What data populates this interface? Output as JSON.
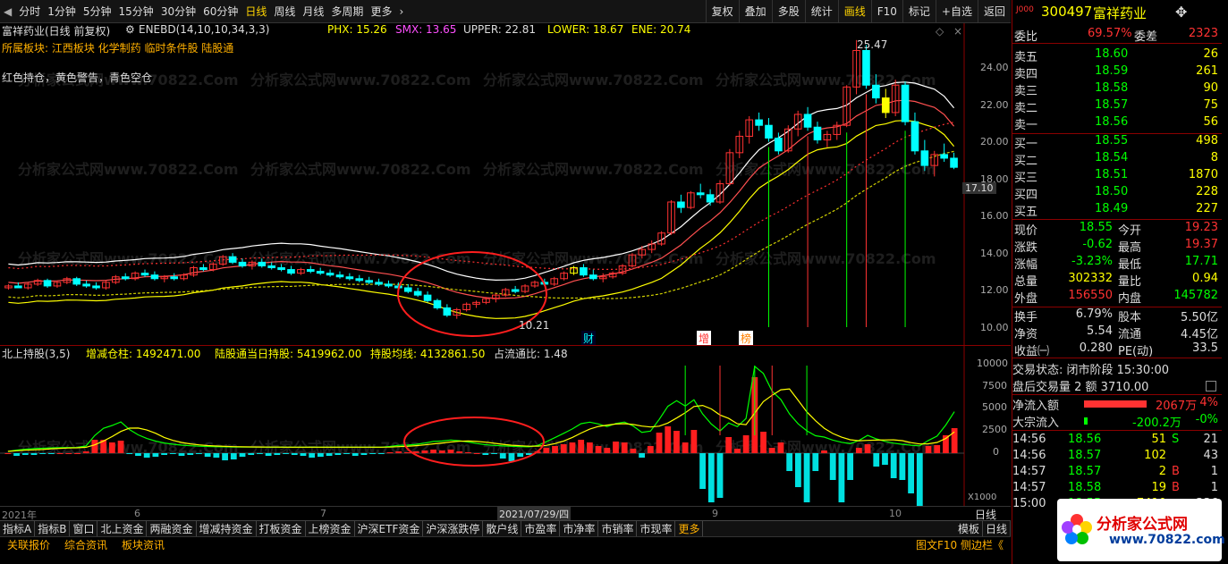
{
  "toolbar": {
    "periods": [
      "分时",
      "1分钟",
      "5分钟",
      "15分钟",
      "30分钟",
      "60分钟",
      "日线",
      "周线",
      "月线",
      "多周期",
      "更多"
    ],
    "active_period": "日线",
    "right_buttons": [
      "复权",
      "叠加",
      "多股",
      "统计",
      "画线",
      "F10",
      "标记",
      "+自选",
      "返回"
    ],
    "active_right": "画线"
  },
  "main": {
    "title": "富祥药业(日线 前复权)",
    "indicator_name": "ENEBD(14,10,10,34,3,3)",
    "phx": "PHX: 15.26",
    "smx": "SMX: 13.65",
    "upper": "UPPER: 22.81",
    "lower": "LOWER: 18.67",
    "ene": "ENE: 20.74",
    "sector": "所属板块: 江西板块 化学制药 临时条件股 陆股通",
    "legend_note": "红色持仓，黄色警告，青色空仓",
    "high_label": "25.47",
    "low_label": "10.21",
    "current_price_tag": "17.10",
    "price_axis": [
      "24.00",
      "22.00",
      "20.00",
      "18.00",
      "16.00",
      "14.00",
      "12.00",
      "10.00"
    ],
    "markers": [
      "财",
      "增",
      "榜"
    ]
  },
  "sub": {
    "title": "北上持股(3,5)",
    "zengjian": "增减仓柱: 1492471.00",
    "today_hold": "陆股通当日持股: 5419962.00",
    "avg_hold": "持股均线: 4132861.50",
    "ratio": "占流通比: 1.48",
    "axis": [
      "10000",
      "7500",
      "5000",
      "2500",
      "0"
    ],
    "axis_unit": "X1000",
    "date_axis": [
      "2021年",
      "6",
      "7",
      "2021/07/29/四",
      "9",
      "10"
    ],
    "period_label": "日线"
  },
  "bottom_tabs": [
    "指标A",
    "指标B",
    "窗口",
    "北上资金",
    "两融资金",
    "增减持资金",
    "打板资金",
    "上榜资金",
    "沪深ETF资金",
    "沪深涨跌停",
    "散户线",
    "市盈率",
    "市净率",
    "市销率",
    "市现率",
    "更多"
  ],
  "bottom_right": [
    "模板",
    "日线"
  ],
  "bottom_links": [
    "关联报价",
    "综合资讯",
    "板块资讯"
  ],
  "bottom_right_links": "图文F10 侧边栏《",
  "quote": {
    "code": "300497",
    "name": "富祥药业",
    "weibi_label": "委比",
    "weibi": "69.57%",
    "weicha_label": "委差",
    "weicha": "2323",
    "sell": [
      {
        "label": "卖五",
        "price": "18.60",
        "vol": "26"
      },
      {
        "label": "卖四",
        "price": "18.59",
        "vol": "261"
      },
      {
        "label": "卖三",
        "price": "18.58",
        "vol": "90"
      },
      {
        "label": "卖二",
        "price": "18.57",
        "vol": "75"
      },
      {
        "label": "卖一",
        "price": "18.56",
        "vol": "56"
      }
    ],
    "buy": [
      {
        "label": "买一",
        "price": "18.55",
        "vol": "498"
      },
      {
        "label": "买二",
        "price": "18.54",
        "vol": "8"
      },
      {
        "label": "买三",
        "price": "18.51",
        "vol": "1870"
      },
      {
        "label": "买四",
        "price": "18.50",
        "vol": "228"
      },
      {
        "label": "买五",
        "price": "18.49",
        "vol": "227"
      }
    ],
    "stats": [
      {
        "l1": "现价",
        "v1": "18.55",
        "l2": "今开",
        "v2": "19.23",
        "c1": "green",
        "c2": "red"
      },
      {
        "l1": "涨跌",
        "v1": "-0.62",
        "l2": "最高",
        "v2": "19.37",
        "c1": "green",
        "c2": "red"
      },
      {
        "l1": "涨幅",
        "v1": "-3.23%",
        "l2": "最低",
        "v2": "17.71",
        "c1": "green",
        "c2": "green"
      },
      {
        "l1": "总量",
        "v1": "302332",
        "l2": "量比",
        "v2": "0.94",
        "c1": "yellow",
        "c2": "yellow"
      },
      {
        "l1": "外盘",
        "v1": "156550",
        "l2": "内盘",
        "v2": "145782",
        "c1": "red",
        "c2": "green"
      }
    ],
    "stats2": [
      {
        "l1": "换手",
        "v1": "6.79%",
        "l2": "股本",
        "v2": "5.50亿"
      },
      {
        "l1": "净资",
        "v1": "5.54",
        "l2": "流通",
        "v2": "4.45亿"
      },
      {
        "l1": "收益㈠",
        "v1": "0.280",
        "l2": "PE(动)",
        "v2": "33.5"
      }
    ],
    "trade_status": "交易状态: 闭市阶段 15:30:00",
    "after_hours": "盘后交易量 2 额 3710.00",
    "net_inflow_label": "净流入额",
    "net_inflow": "2067万",
    "net_inflow_pct": "4%",
    "block_label": "大宗流入",
    "block": "-200.2万",
    "block_pct": "-0%",
    "ticks": [
      {
        "t": "14:56",
        "p": "18.56",
        "v": "51",
        "f": "S",
        "n": "21"
      },
      {
        "t": "14:56",
        "p": "18.57",
        "v": "102",
        "f": "",
        "n": "43"
      },
      {
        "t": "14:57",
        "p": "18.57",
        "v": "2",
        "f": "B",
        "n": "1"
      },
      {
        "t": "14:57",
        "p": "18.58",
        "v": "19",
        "f": "B",
        "n": "1"
      },
      {
        "t": "15:00",
        "p": "18.55",
        "v": "7410",
        "f": "",
        "n": "336"
      }
    ],
    "brand": "分析家公式网",
    "brand_url": "www.70822.com"
  },
  "chart_data": {
    "type": "candlestick",
    "y_range": [
      9.5,
      26.0
    ],
    "candles": [
      [
        11.9,
        12.1,
        11.8,
        12.0
      ],
      [
        12.0,
        12.2,
        11.9,
        11.9
      ],
      [
        11.9,
        12.2,
        11.8,
        12.1
      ],
      [
        12.1,
        12.4,
        12.0,
        12.3
      ],
      [
        12.3,
        12.4,
        11.9,
        12.0
      ],
      [
        12.0,
        12.3,
        11.9,
        12.2
      ],
      [
        12.2,
        12.5,
        12.1,
        12.4
      ],
      [
        12.4,
        12.5,
        12.0,
        12.1
      ],
      [
        12.1,
        12.3,
        11.9,
        12.0
      ],
      [
        12.0,
        12.2,
        11.8,
        11.9
      ],
      [
        11.9,
        12.3,
        11.8,
        12.2
      ],
      [
        12.2,
        12.6,
        12.1,
        12.5
      ],
      [
        12.5,
        12.7,
        12.3,
        12.4
      ],
      [
        12.4,
        12.8,
        12.3,
        12.7
      ],
      [
        12.7,
        12.9,
        12.5,
        12.6
      ],
      [
        12.6,
        12.8,
        12.3,
        12.4
      ],
      [
        12.4,
        12.6,
        12.2,
        12.5
      ],
      [
        12.5,
        12.7,
        12.3,
        12.4
      ],
      [
        12.4,
        12.7,
        12.3,
        12.6
      ],
      [
        12.6,
        13.1,
        12.5,
        13.0
      ],
      [
        13.0,
        13.2,
        12.8,
        12.9
      ],
      [
        12.9,
        13.3,
        12.8,
        13.2
      ],
      [
        13.2,
        13.7,
        13.1,
        13.6
      ],
      [
        13.6,
        13.8,
        13.2,
        13.3
      ],
      [
        13.3,
        13.5,
        13.0,
        13.1
      ],
      [
        13.1,
        13.4,
        12.9,
        13.3
      ],
      [
        13.3,
        13.5,
        13.0,
        13.1
      ],
      [
        13.1,
        13.3,
        12.9,
        13.0
      ],
      [
        13.0,
        13.2,
        12.8,
        12.9
      ],
      [
        12.9,
        13.1,
        12.6,
        12.7
      ],
      [
        12.7,
        13.0,
        12.6,
        12.9
      ],
      [
        12.9,
        13.1,
        12.7,
        12.8
      ],
      [
        12.8,
        13.0,
        12.6,
        12.7
      ],
      [
        12.7,
        12.9,
        12.5,
        12.6
      ],
      [
        12.6,
        12.8,
        12.4,
        12.5
      ],
      [
        12.5,
        12.7,
        12.3,
        12.4
      ],
      [
        12.4,
        12.6,
        12.2,
        12.3
      ],
      [
        12.3,
        12.5,
        12.1,
        12.2
      ],
      [
        12.2,
        12.4,
        12.0,
        12.1
      ],
      [
        12.1,
        12.3,
        11.9,
        12.0
      ],
      [
        12.0,
        12.2,
        11.8,
        11.9
      ],
      [
        11.9,
        12.1,
        11.6,
        11.7
      ],
      [
        11.7,
        11.9,
        11.4,
        11.5
      ],
      [
        11.5,
        11.7,
        11.1,
        11.2
      ],
      [
        11.2,
        11.3,
        10.7,
        10.8
      ],
      [
        10.8,
        11.0,
        10.3,
        10.4
      ],
      [
        10.4,
        10.8,
        10.2,
        10.7
      ],
      [
        10.7,
        11.1,
        10.6,
        11.0
      ],
      [
        11.0,
        11.2,
        10.8,
        11.1
      ],
      [
        11.1,
        11.4,
        11.0,
        11.3
      ],
      [
        11.3,
        11.6,
        11.1,
        11.5
      ],
      [
        11.5,
        11.9,
        11.4,
        11.8
      ],
      [
        11.8,
        12.0,
        11.6,
        11.7
      ],
      [
        11.7,
        12.1,
        11.6,
        12.0
      ],
      [
        12.0,
        12.3,
        11.9,
        12.2
      ],
      [
        12.2,
        12.4,
        12.0,
        12.1
      ],
      [
        12.1,
        12.5,
        12.0,
        12.4
      ],
      [
        12.4,
        12.8,
        12.3,
        12.7
      ],
      [
        12.7,
        13.1,
        12.6,
        13.0
      ],
      [
        13.0,
        13.2,
        12.5,
        12.6
      ],
      [
        12.6,
        12.9,
        12.3,
        12.4
      ],
      [
        12.4,
        12.7,
        12.2,
        12.5
      ],
      [
        12.5,
        12.8,
        12.4,
        12.7
      ],
      [
        12.7,
        13.2,
        12.6,
        13.1
      ],
      [
        13.1,
        13.8,
        13.0,
        13.7
      ],
      [
        13.7,
        14.2,
        13.5,
        14.0
      ],
      [
        14.0,
        14.5,
        13.8,
        14.3
      ],
      [
        14.3,
        15.0,
        14.2,
        14.9
      ],
      [
        14.9,
        16.7,
        14.8,
        16.6
      ],
      [
        16.6,
        17.0,
        16.0,
        16.3
      ],
      [
        16.3,
        17.2,
        16.2,
        17.1
      ],
      [
        17.1,
        17.6,
        16.8,
        17.0
      ],
      [
        17.0,
        17.3,
        16.4,
        16.6
      ],
      [
        16.6,
        17.8,
        16.5,
        17.6
      ],
      [
        17.6,
        19.5,
        17.5,
        19.3
      ],
      [
        19.3,
        20.5,
        19.0,
        20.2
      ],
      [
        20.2,
        21.3,
        19.8,
        21.1
      ],
      [
        21.1,
        21.5,
        20.5,
        20.8
      ],
      [
        20.8,
        21.2,
        19.9,
        20.1
      ],
      [
        20.1,
        20.4,
        19.2,
        19.4
      ],
      [
        19.4,
        20.8,
        19.3,
        20.6
      ],
      [
        20.6,
        21.6,
        20.2,
        21.4
      ],
      [
        21.4,
        21.8,
        20.5,
        20.7
      ],
      [
        20.7,
        21.0,
        19.8,
        20.0
      ],
      [
        20.0,
        20.5,
        19.6,
        20.3
      ],
      [
        20.3,
        21.0,
        20.0,
        20.8
      ],
      [
        20.8,
        23.0,
        20.7,
        22.9
      ],
      [
        22.9,
        25.47,
        22.5,
        24.9
      ],
      [
        24.9,
        25.2,
        22.8,
        23.0
      ],
      [
        23.0,
        23.6,
        22.0,
        22.3
      ],
      [
        22.3,
        22.8,
        21.2,
        21.5
      ],
      [
        21.5,
        23.3,
        21.3,
        23.0
      ],
      [
        23.0,
        23.2,
        20.8,
        21.0
      ],
      [
        21.0,
        21.5,
        19.2,
        19.4
      ],
      [
        19.4,
        20.0,
        18.3,
        18.6
      ],
      [
        18.6,
        19.4,
        18.0,
        19.2
      ],
      [
        19.2,
        19.8,
        18.8,
        19.0
      ],
      [
        19.0,
        19.3,
        18.4,
        18.5
      ]
    ],
    "holding_bars": [
      0,
      -300,
      -200,
      -200,
      -100,
      -100,
      0,
      0,
      0,
      200,
      1500,
      1500,
      1200,
      1400,
      -100,
      -300,
      -500,
      -400,
      -200,
      -100,
      -300,
      -200,
      -100,
      -400,
      -500,
      -800,
      -700,
      -400,
      -200,
      -100,
      -300,
      -200,
      -100,
      -200,
      -300,
      -500,
      -400,
      -300,
      -200,
      -100,
      -300,
      -200,
      -100,
      -100,
      100,
      200,
      100,
      200,
      300,
      400,
      300,
      400,
      200,
      100,
      0,
      -200,
      -100,
      -600,
      -900,
      -400,
      -200,
      200,
      600,
      800,
      1000,
      1200,
      1500,
      1200,
      800,
      600,
      1300,
      1200,
      500,
      -500,
      800,
      2300,
      3000,
      2500,
      1200,
      2600,
      -4000,
      -5500,
      -5000,
      1800,
      500,
      2000,
      8500,
      2400,
      600,
      1200,
      -2000,
      -3800,
      -5500,
      -2000,
      300,
      -3000,
      -5500,
      -3000,
      600,
      1000,
      -1500,
      -1300,
      -2800,
      -3000,
      -4500,
      -6500,
      800,
      900,
      2000,
      2800
    ]
  }
}
